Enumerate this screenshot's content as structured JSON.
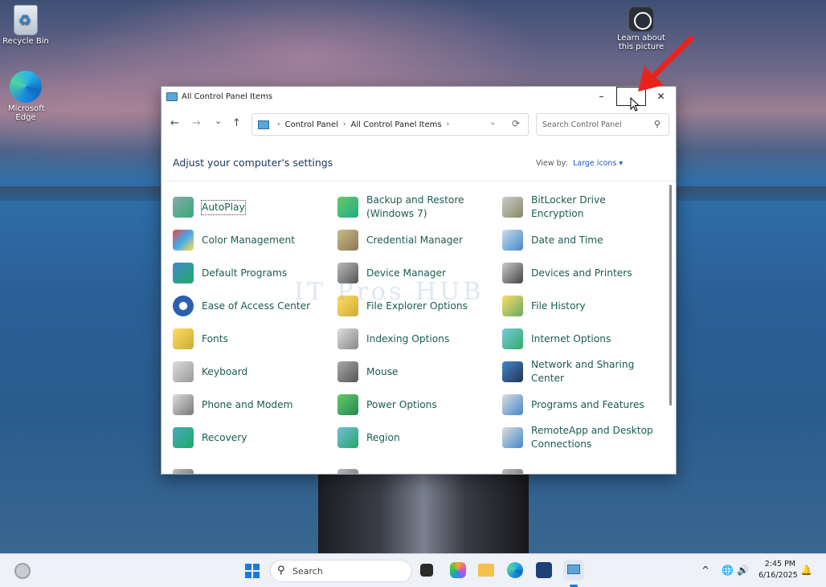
{
  "desktop": {
    "icons": [
      {
        "label": "Recycle Bin"
      },
      {
        "label": "Microsoft Edge"
      },
      {
        "label": "Learn about this picture"
      }
    ]
  },
  "window": {
    "title": "All Control Panel Items",
    "controls": {
      "minimize": "–",
      "close": "✕"
    },
    "nav": {
      "back": "←",
      "forward": "→",
      "recent": "⌄",
      "up": "↑"
    },
    "address": {
      "crumbs": [
        "Control Panel",
        "All Control Panel Items"
      ],
      "separator": "›"
    },
    "search": {
      "placeholder": "Search Control Panel"
    },
    "heading": "Adjust your computer's settings",
    "view_by_label": "View by:",
    "view_by_value": "Large icons ▾",
    "items": [
      {
        "label": "AutoPlay",
        "icon": "autoplay-icon"
      },
      {
        "label": "Backup and Restore (Windows 7)",
        "icon": "backup-icon"
      },
      {
        "label": "BitLocker Drive Encryption",
        "icon": "bitlocker-icon"
      },
      {
        "label": "Color Management",
        "icon": "color-management-icon"
      },
      {
        "label": "Credential Manager",
        "icon": "credential-icon"
      },
      {
        "label": "Date and Time",
        "icon": "calendar-icon"
      },
      {
        "label": "Default Programs",
        "icon": "default-programs-icon"
      },
      {
        "label": "Device Manager",
        "icon": "device-manager-icon"
      },
      {
        "label": "Devices and Printers",
        "icon": "printer-icon"
      },
      {
        "label": "Ease of Access Center",
        "icon": "ease-of-access-icon"
      },
      {
        "label": "File Explorer Options",
        "icon": "folder-options-icon"
      },
      {
        "label": "File History",
        "icon": "file-history-icon"
      },
      {
        "label": "Fonts",
        "icon": "fonts-icon"
      },
      {
        "label": "Indexing Options",
        "icon": "indexing-icon"
      },
      {
        "label": "Internet Options",
        "icon": "internet-icon"
      },
      {
        "label": "Keyboard",
        "icon": "keyboard-icon"
      },
      {
        "label": "Mouse",
        "icon": "mouse-icon"
      },
      {
        "label": "Network and Sharing Center",
        "icon": "network-icon"
      },
      {
        "label": "Phone and Modem",
        "icon": "phone-icon"
      },
      {
        "label": "Power Options",
        "icon": "power-icon"
      },
      {
        "label": "Programs and Features",
        "icon": "programs-icon"
      },
      {
        "label": "Recovery",
        "icon": "recovery-icon"
      },
      {
        "label": "Region",
        "icon": "region-icon"
      },
      {
        "label": "RemoteApp and Desktop Connections",
        "icon": "remoteapp-icon"
      }
    ],
    "watermark": "IT Pros HUB"
  },
  "taskbar": {
    "search_label": "Search",
    "tray_chevron": "^",
    "time": "2:45 PM",
    "date": "6/16/2025"
  },
  "colors": {
    "link": "#1a5c52",
    "heading": "#1d3660",
    "accent": "#1f5fbf",
    "arrow": "#e8231e"
  }
}
